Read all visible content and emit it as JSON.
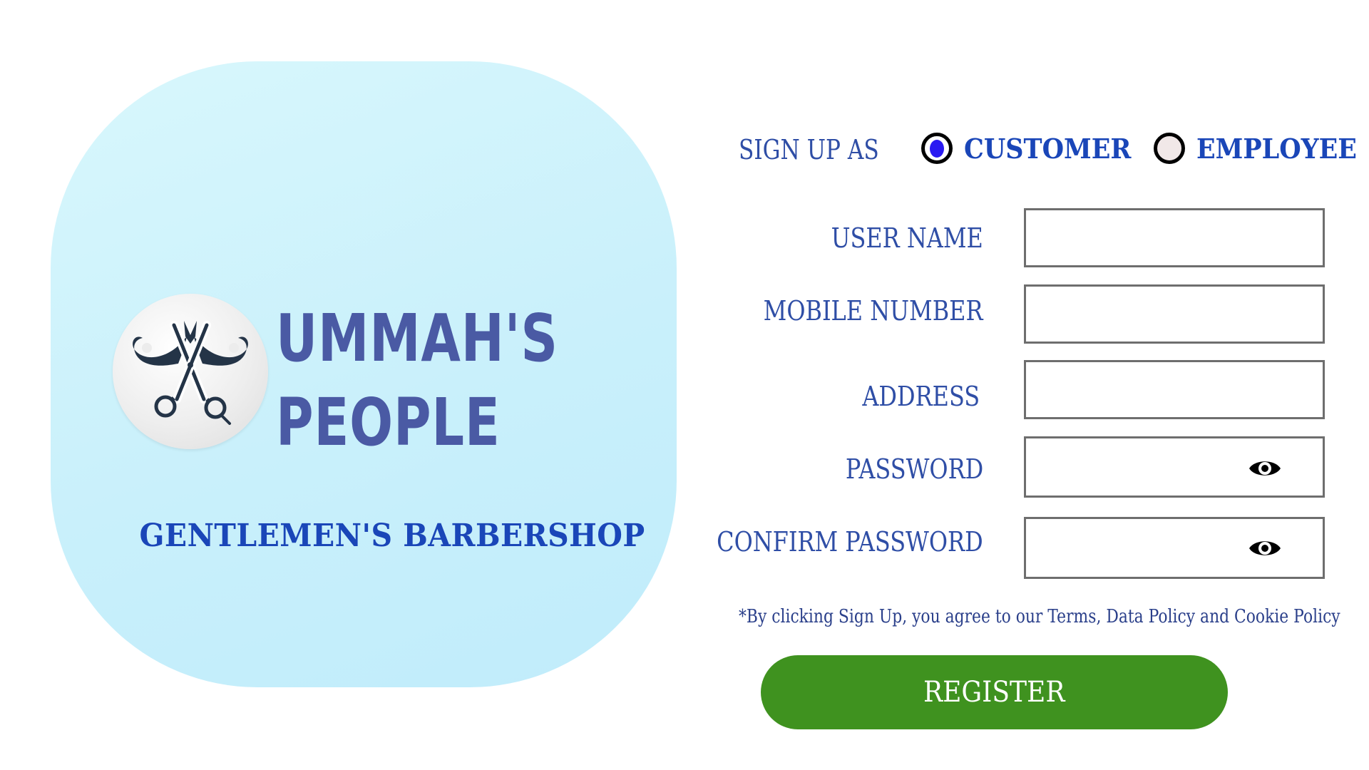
{
  "brand": {
    "logo_line1": "UMMAH'S",
    "logo_line2": "PEOPLE",
    "tagline": "GENTLEMEN'S BARBERSHOP",
    "logo_icon": "mustache-scissors-icon"
  },
  "signup": {
    "label": "SIGN UP AS",
    "options": [
      {
        "label": "CUSTOMER",
        "selected": true
      },
      {
        "label": "EMPLOYEE",
        "selected": false
      }
    ]
  },
  "form": {
    "fields": [
      {
        "label": "USER NAME",
        "value": "",
        "type": "text"
      },
      {
        "label": "MOBILE NUMBER",
        "value": "",
        "type": "tel"
      },
      {
        "label": "ADDRESS",
        "value": "",
        "type": "text"
      },
      {
        "label": "PASSWORD",
        "value": "",
        "type": "password",
        "icon": "eye-icon"
      },
      {
        "label": "CONFIRM PASSWORD",
        "value": "",
        "type": "password",
        "icon": "eye-icon"
      }
    ],
    "terms_text": "*By clicking Sign Up, you agree to our Terms, Data Policy and Cookie Policy",
    "register_label": "REGISTER"
  },
  "colors": {
    "card_background": "#c9f0fb",
    "label_blue": "#2f4ea6",
    "accent_blue": "#1a46b8",
    "radio_dot": "#2a1af2",
    "register_green": "#3f921f"
  }
}
